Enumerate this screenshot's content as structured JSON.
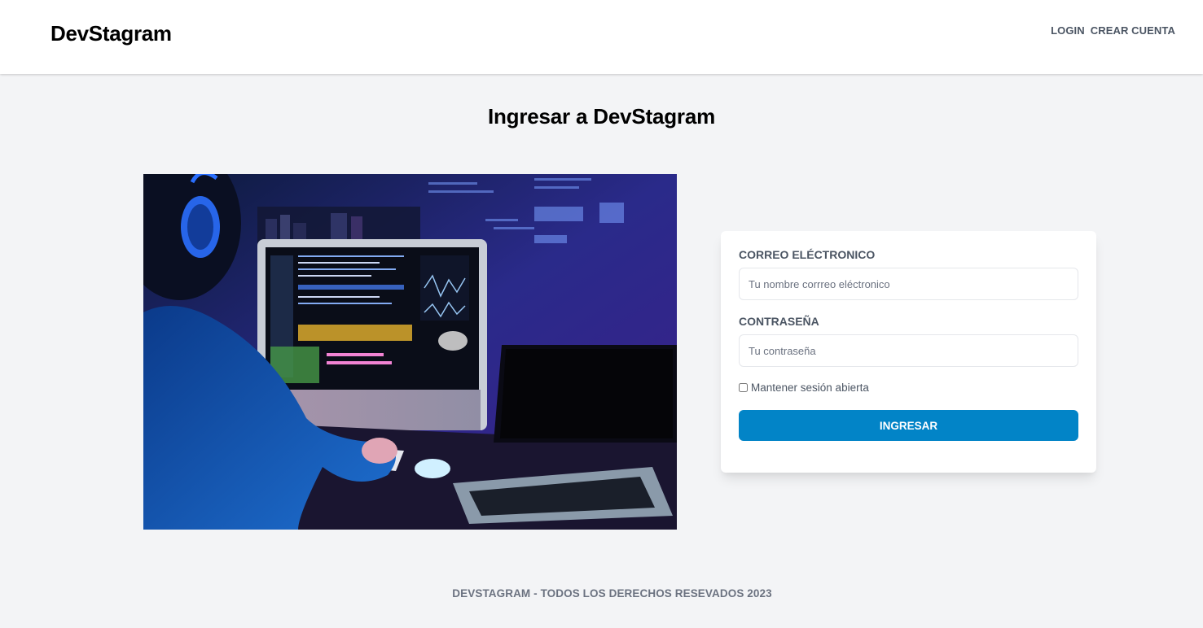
{
  "header": {
    "logo": "DevStagram",
    "nav": [
      {
        "label": "Login"
      },
      {
        "label": "Crear Cuenta"
      }
    ]
  },
  "main": {
    "title": "Ingresar a DevStagram",
    "hero_image": {
      "icon": "developer-at-workstation-photo"
    }
  },
  "form": {
    "email": {
      "label": "Correo Eléctronico",
      "placeholder": "Tu nombre corrreo eléctronico",
      "value": ""
    },
    "password": {
      "label": "Contraseña",
      "placeholder": "Tu contraseña",
      "value": ""
    },
    "remember": {
      "label": "Mantener sesión abierta",
      "checked": false
    },
    "submit_label": "Ingresar"
  },
  "footer": {
    "text": "DevStagram - Todos los derechos resevados 2023"
  },
  "colors": {
    "accent": "#0284c7",
    "background": "#f3f4f6",
    "card": "#ffffff"
  }
}
